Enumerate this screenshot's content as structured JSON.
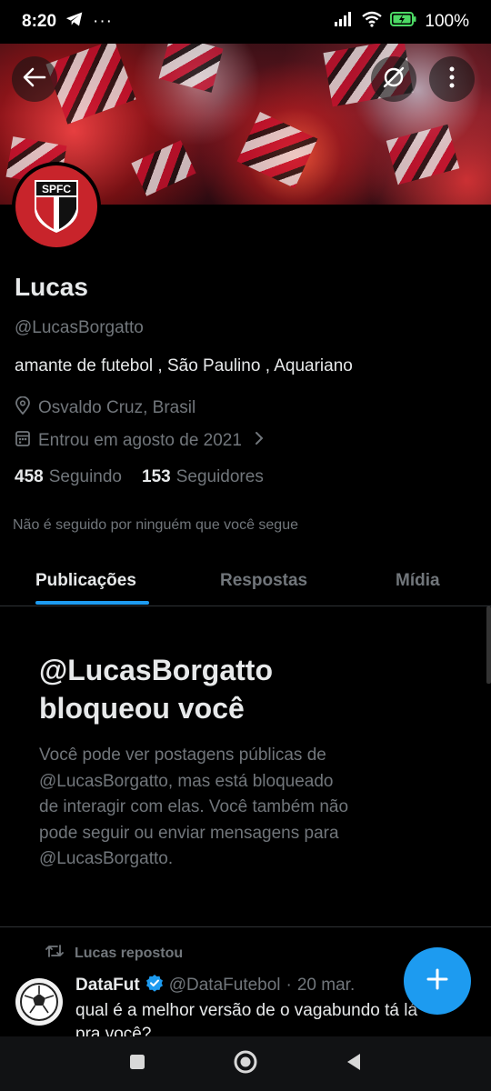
{
  "status_bar": {
    "time": "8:20",
    "notif_icons": [
      "telegram-icon",
      "more-dots-icon"
    ],
    "right_icons": [
      "signal-icon",
      "wifi-icon",
      "battery-charging-icon"
    ],
    "battery": "100%"
  },
  "banner": {
    "back_icon": "arrow-left-icon",
    "action_icon": "empty-set-icon",
    "menu_icon": "more-vertical-icon"
  },
  "profile": {
    "avatar_text": "SPFC",
    "name": "Lucas",
    "handle": "@LucasBorgatto",
    "bio": "amante de futebol , São Paulino , Aquariano",
    "location": "Osvaldo Cruz, Brasil",
    "joined": "Entrou em agosto de 2021",
    "following_count": "458",
    "following_label": "Seguindo",
    "followers_count": "153",
    "followers_label": "Seguidores",
    "not_followed": "Não é seguido por ninguém que você segue"
  },
  "tabs": [
    {
      "label": "Publicações",
      "active": true
    },
    {
      "label": "Respostas",
      "active": false
    },
    {
      "label": "Mídia",
      "active": false
    }
  ],
  "blocked": {
    "title_line1": "@LucasBorgatto",
    "title_line2": "bloqueou você",
    "lines": [
      "Você pode ver postagens públicas de",
      "@LucasBorgatto, mas está bloqueado",
      "de interagir com elas. Você também não",
      "pode seguir ou enviar mensagens para",
      "@LucasBorgatto."
    ]
  },
  "tweet": {
    "repost_label": "Lucas repostou",
    "author_name": "DataFut",
    "author_handle": "@DataFutebol",
    "separator": "·",
    "date": "20 mar.",
    "line1": "qual é a melhor versão de o vagabundo tá lá",
    "line2": "pra você?"
  },
  "colors": {
    "accent": "#1d9bf0",
    "background": "#000000",
    "text_primary": "#e7e9ea",
    "text_secondary": "#71767b",
    "avatar_red": "#c8242b"
  }
}
